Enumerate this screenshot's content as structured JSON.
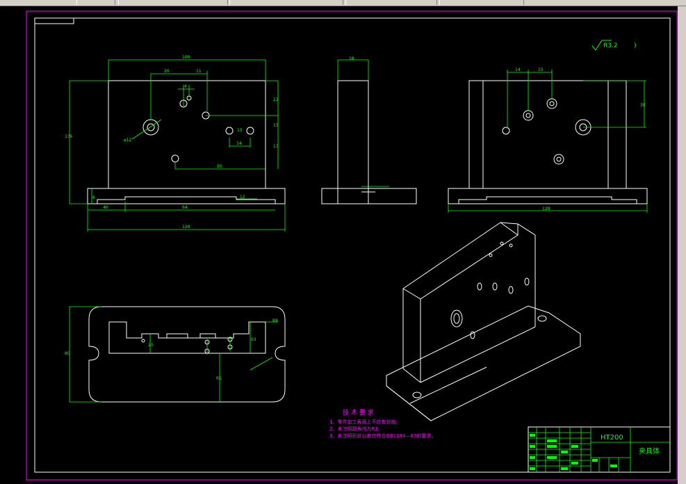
{
  "colors": {
    "background": "#000000",
    "outline": "#ffffff",
    "dimension": "#00ff00",
    "border": "#ff00ff",
    "notes": "#ff00ff",
    "titleblock": "#00ff00"
  },
  "front_view": {
    "dims": {
      "top_width": "100",
      "d20": "20",
      "d11": "11",
      "d4": "4",
      "d22": "22",
      "d15": "15",
      "d14": "14",
      "d13": "13",
      "d50": "50",
      "hole": "⌀12",
      "d15b": "15",
      "d40": "40",
      "d12": "12",
      "d64": "64",
      "overall": "120",
      "left_h": "136",
      "d8": "8"
    }
  },
  "side_view": {
    "dims": {
      "top": "18"
    }
  },
  "right_view": {
    "dims": {
      "d14": "14",
      "d15": "15",
      "d30": "30",
      "overall": "120"
    }
  },
  "plan_view": {
    "dims": {
      "right": "R8",
      "d20": "20",
      "d63": "63",
      "height": "80",
      "r": "R5"
    }
  },
  "surface_finish": "R3.2",
  "surface_finish_suffix": ")",
  "tech_requirements": {
    "title": "技 术 要 求",
    "items": [
      "1、零件加工表面上不应有划痕;",
      "2、未注明圆角均为R3;",
      "3、未注明形状公差应符合GB1184—80的要求。"
    ]
  },
  "title_block": {
    "material": "HT200",
    "part_name": "夹具体"
  }
}
